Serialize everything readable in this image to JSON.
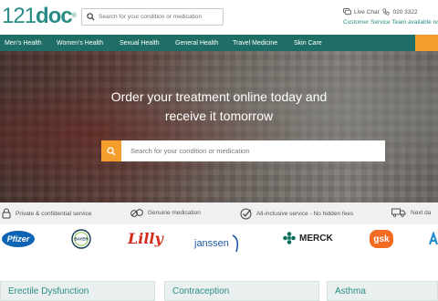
{
  "header": {
    "logo_num": "121",
    "logo_txt": "doc",
    "logo_reg": "®",
    "search_placeholder": "Search for your condition or medication",
    "live_chat": "Live Chat",
    "phone": "020 3322",
    "availability": "Customer Service Team available now"
  },
  "nav": {
    "items": [
      "Men's Health",
      "Women's Health",
      "Sexual Health",
      "General Health",
      "Travel Medicine",
      "Skin Care"
    ]
  },
  "hero": {
    "headline_line1": "Order your treatment online today and",
    "headline_line2": "receive it tomorrow",
    "search_placeholder": "Search for your condition or medication"
  },
  "usp": {
    "items": [
      "Private & confidential service",
      "Genuine medication",
      "All-inclusive service - No hidden fees",
      "Next da"
    ]
  },
  "brands": {
    "pfizer": "Pfizer",
    "bayer": "BAYER",
    "lilly": "Lilly",
    "janssen": "janssen",
    "merck": "MERCK",
    "gsk": "gsk"
  },
  "categories": [
    "Erectile Dysfunction",
    "Contraception",
    "Asthma"
  ],
  "colors": {
    "brand_teal": "#1f6e66",
    "accent_orange": "#f59e2e"
  }
}
